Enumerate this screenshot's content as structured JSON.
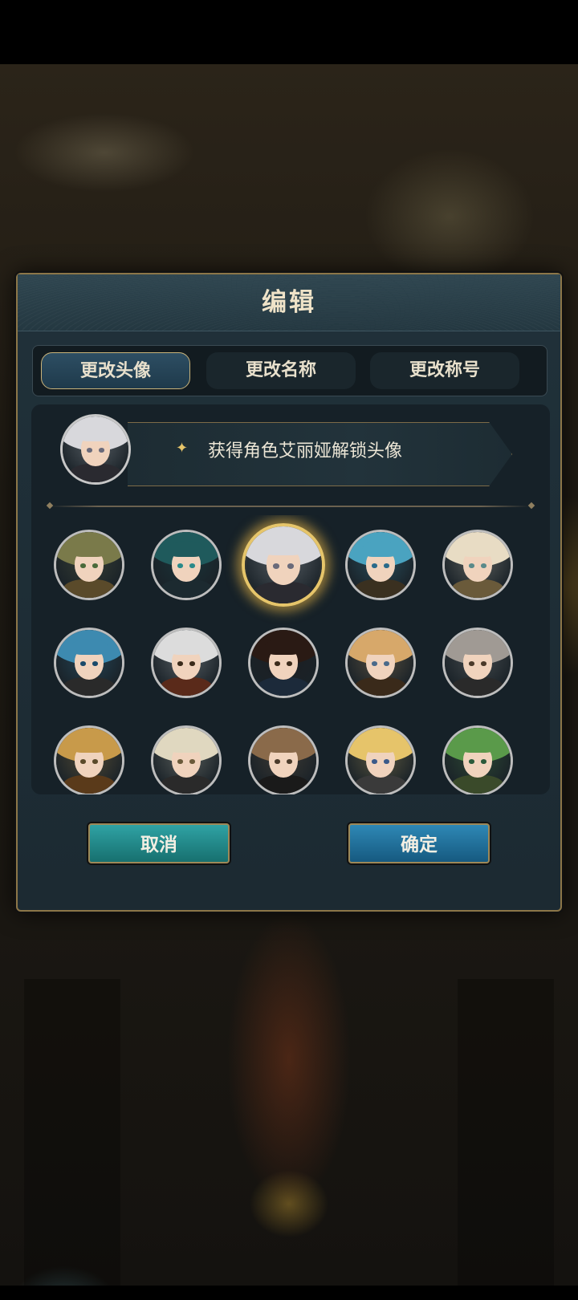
{
  "dialog": {
    "title": "编辑",
    "tabs": [
      {
        "label": "更改头像",
        "active": true
      },
      {
        "label": "更改名称",
        "active": false
      },
      {
        "label": "更改称号",
        "active": false
      }
    ],
    "unlock_hint": "获得角色艾丽娅解锁头像",
    "unlock_icon": "sparkle-icon",
    "buttons": {
      "cancel": "取消",
      "confirm": "确定"
    }
  },
  "avatars": [
    {
      "name": "green-haired-elf",
      "hair": "#7a7a4a",
      "eye": "#4a6a3a",
      "body": "#5a4a2a",
      "selected": false
    },
    {
      "name": "teal-haired-girl",
      "hair": "#1f5a5c",
      "eye": "#2a8a8a",
      "body": "#1c2a30",
      "selected": false
    },
    {
      "name": "white-haired-girl",
      "hair": "#d8d8dc",
      "eye": "#6a6a7a",
      "body": "#2a2a30",
      "selected": true
    },
    {
      "name": "blue-haired-goggles",
      "hair": "#4aa3c0",
      "eye": "#2a6a8a",
      "body": "#3a3020",
      "selected": false
    },
    {
      "name": "blonde-elf-glasses",
      "hair": "#e8dcc4",
      "eye": "#5a8a8a",
      "body": "#6a5a3a",
      "selected": false
    },
    {
      "name": "blue-haired-book",
      "hair": "#3d8ab0",
      "eye": "#1a4a6a",
      "body": "#2a2a2a",
      "selected": false
    },
    {
      "name": "white-haired-bandana",
      "hair": "#dcdcdc",
      "eye": "#3a2a1a",
      "body": "#5a2a1a",
      "selected": false
    },
    {
      "name": "dark-haired-glasses",
      "hair": "#2a1a14",
      "eye": "#3a2a1a",
      "body": "#1c2a3a",
      "selected": false
    },
    {
      "name": "blonde-hairclip-girl",
      "hair": "#d7a86a",
      "eye": "#4a6a8a",
      "body": "#3a2a1a",
      "selected": false
    },
    {
      "name": "silver-haired-man",
      "hair": "#a09a94",
      "eye": "#4a3a2a",
      "body": "#2a2a2a",
      "selected": false
    },
    {
      "name": "golden-haired-man",
      "hair": "#c89a4a",
      "eye": "#5a4a2a",
      "body": "#5a3a1a",
      "selected": false
    },
    {
      "name": "hat-white-haired",
      "hair": "#e0d8c0",
      "eye": "#6a5a3a",
      "body": "#2a2a2a",
      "selected": false
    },
    {
      "name": "nun-brown-haired",
      "hair": "#8a6a4a",
      "eye": "#4a3a2a",
      "body": "#1a1a1a",
      "selected": false
    },
    {
      "name": "blonde-cheerful-girl",
      "hair": "#e6c46a",
      "eye": "#3a5a8a",
      "body": "#3a3a3a",
      "selected": false
    },
    {
      "name": "green-haired-elf-girl",
      "hair": "#5a9a4a",
      "eye": "#2a5a3a",
      "body": "#3a4a2a",
      "selected": false
    }
  ]
}
